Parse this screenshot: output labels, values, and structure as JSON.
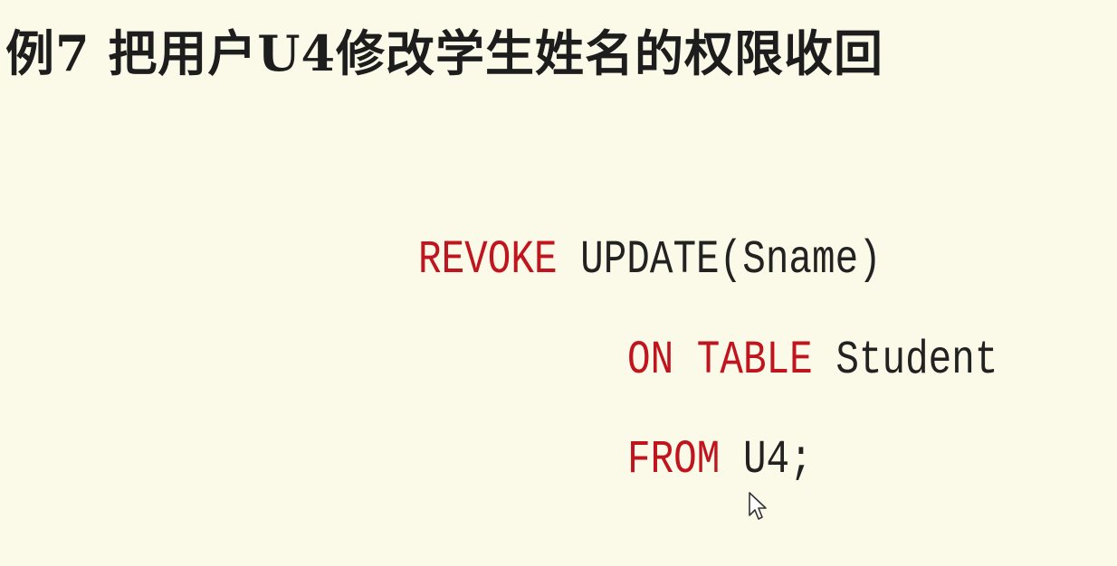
{
  "slide": {
    "title": "例7 把用户U4修改学生姓名的权限收回",
    "code": {
      "line1": {
        "keyword": "REVOKE",
        "rest": " UPDATE(Sname)"
      },
      "line2": {
        "keyword1": "ON",
        "keyword2": "TABLE",
        "rest": " Student"
      },
      "line3": {
        "keyword": "FROM",
        "rest": " U4;"
      }
    },
    "colors": {
      "background": "#fbf9e7",
      "keyword": "#c0141e",
      "text": "#222222"
    },
    "icons": {
      "cursor": "mouse-pointer-icon"
    }
  }
}
